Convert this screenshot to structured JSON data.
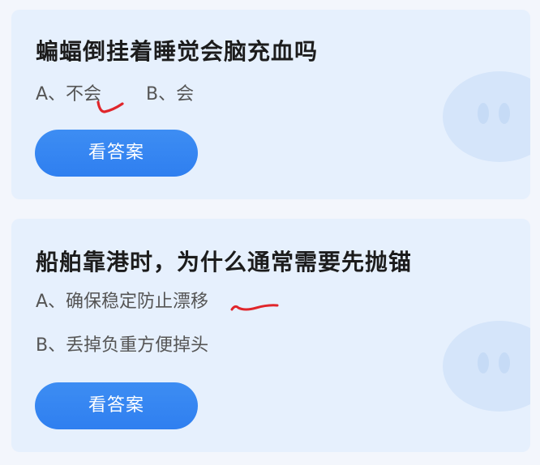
{
  "cards": [
    {
      "question": "蝙蝠倒挂着睡觉会脑充血吗",
      "option_a": "A、不会",
      "option_b": "B、会",
      "button_label": "看答案"
    },
    {
      "question": "船舶靠港时，为什么通常需要先抛锚",
      "option_a": "A、确保稳定防止漂移",
      "option_b": "B、丢掉负重方便掉头",
      "button_label": "看答案"
    }
  ],
  "colors": {
    "background": "#f3f6fc",
    "card": "#e6f0fd",
    "button": "#3485f1",
    "mark": "#e0262b"
  },
  "icons": [
    "mascot-watermark-icon",
    "handwritten-check-icon",
    "handwritten-underline-icon"
  ]
}
